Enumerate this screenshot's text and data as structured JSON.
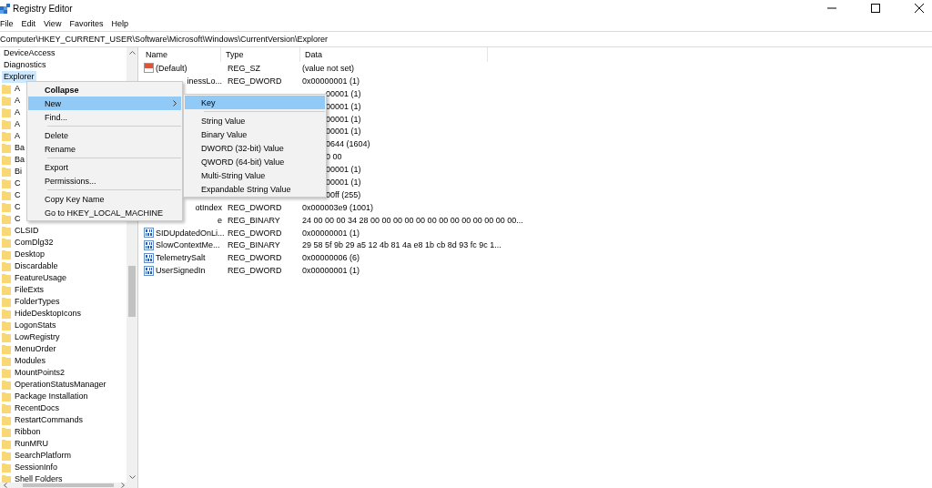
{
  "window": {
    "title": "Registry Editor"
  },
  "menu_bar": [
    "File",
    "Edit",
    "View",
    "Favorites",
    "Help"
  ],
  "address_bar": "Computer\\HKEY_CURRENT_USER\\Software\\Microsoft\\Windows\\CurrentVersion\\Explorer",
  "tree": [
    {
      "label": "DeviceAccess",
      "selected": false
    },
    {
      "label": "Diagnostics",
      "selected": false
    },
    {
      "label": "Explorer",
      "selected": true,
      "children": [
        {
          "label": "A",
          "selected": false
        },
        {
          "label": "A",
          "selected": false
        },
        {
          "label": "A",
          "selected": false
        },
        {
          "label": "A",
          "selected": false
        },
        {
          "label": "A",
          "selected": false
        },
        {
          "label": "Ba",
          "selected": false
        },
        {
          "label": "Ba",
          "selected": false
        },
        {
          "label": "Bi",
          "selected": false
        },
        {
          "label": "C",
          "selected": false
        },
        {
          "label": "C",
          "selected": false
        },
        {
          "label": "C",
          "selected": false
        },
        {
          "label": "C",
          "selected": false
        },
        {
          "label": "CLSID",
          "selected": false
        },
        {
          "label": "ComDlg32",
          "selected": false
        },
        {
          "label": "Desktop",
          "selected": false
        },
        {
          "label": "Discardable",
          "selected": false
        },
        {
          "label": "FeatureUsage",
          "selected": false
        },
        {
          "label": "FileExts",
          "selected": false
        },
        {
          "label": "FolderTypes",
          "selected": false
        },
        {
          "label": "HideDesktopIcons",
          "selected": false
        },
        {
          "label": "LogonStats",
          "selected": false
        },
        {
          "label": "LowRegistry",
          "selected": false
        },
        {
          "label": "MenuOrder",
          "selected": false
        },
        {
          "label": "Modules",
          "selected": false
        },
        {
          "label": "MountPoints2",
          "selected": false
        },
        {
          "label": "OperationStatusManager",
          "selected": false
        },
        {
          "label": "Package Installation",
          "selected": false
        },
        {
          "label": "RecentDocs",
          "selected": false
        },
        {
          "label": "RestartCommands",
          "selected": false
        },
        {
          "label": "Ribbon",
          "selected": false
        },
        {
          "label": "RunMRU",
          "selected": false
        },
        {
          "label": "SearchPlatform",
          "selected": false
        },
        {
          "label": "SessionInfo",
          "selected": false
        },
        {
          "label": "Shell Folders",
          "selected": false
        }
      ]
    }
  ],
  "table": {
    "columns": [
      "Name",
      "Type",
      "Data"
    ],
    "rows": [
      {
        "kind": "string",
        "name": "(Default)",
        "type": "REG_SZ",
        "data": "(value not set)"
      },
      {
        "name": "inessLo...",
        "type": "REG_DWORD",
        "data": "0x00000001 (1)"
      },
      {
        "data": "00001 (1)"
      },
      {
        "data": "00001 (1)"
      },
      {
        "data": "00001 (1)"
      },
      {
        "data": "00001 (1)"
      },
      {
        "data": "0644 (1604)"
      },
      {
        "data": "0 00"
      },
      {
        "data": "00001 (1)"
      },
      {
        "data": "00001 (1)"
      },
      {
        "data": "00ff (255)"
      },
      {
        "name": "otIndex",
        "type": "REG_DWORD",
        "data": "0x000003e9 (1001)"
      },
      {
        "name": "e",
        "type": "REG_BINARY",
        "data": "24 00 00 00 34 28 00 00 00 00 00 00 00 00 00 00 00 00 00..."
      },
      {
        "kind": "binary",
        "name": "SIDUpdatedOnLi...",
        "type": "REG_DWORD",
        "data": "0x00000001 (1)"
      },
      {
        "kind": "binary",
        "name": "SlowContextMe...",
        "type": "REG_BINARY",
        "data": "29 58 5f 9b 29 a5 12 4b 81 4a e8 1b cb 8d 93 fc 9c 1..."
      },
      {
        "kind": "binary",
        "name": "TelemetrySalt",
        "type": "REG_DWORD",
        "data": "0x00000006 (6)"
      },
      {
        "kind": "binary",
        "name": "UserSignedIn",
        "type": "REG_DWORD",
        "data": "0x00000001 (1)"
      }
    ]
  },
  "context_menu": [
    {
      "kind": "item",
      "label": "Collapse",
      "default": true,
      "selected": false
    },
    {
      "kind": "item",
      "label": "New",
      "selected": true,
      "submenu": true
    },
    {
      "kind": "item",
      "label": "Find...",
      "selected": false
    },
    {
      "kind": "separator"
    },
    {
      "kind": "item",
      "label": "Delete",
      "selected": false
    },
    {
      "kind": "item",
      "label": "Rename",
      "selected": false
    },
    {
      "kind": "separator"
    },
    {
      "kind": "item",
      "label": "Export",
      "selected": false
    },
    {
      "kind": "item",
      "label": "Permissions...",
      "selected": false
    },
    {
      "kind": "separator"
    },
    {
      "kind": "item",
      "label": "Copy Key Name",
      "selected": false
    },
    {
      "kind": "item",
      "label": "Go to HKEY_LOCAL_MACHINE",
      "selected": false
    }
  ],
  "submenu": [
    {
      "kind": "item",
      "label": "Key",
      "selected": true
    },
    {
      "kind": "separator"
    },
    {
      "kind": "item",
      "label": "String Value",
      "selected": false
    },
    {
      "kind": "item",
      "label": "Binary Value",
      "selected": false
    },
    {
      "kind": "item",
      "label": "DWORD (32-bit) Value",
      "selected": false
    },
    {
      "kind": "item",
      "label": "QWORD (64-bit) Value",
      "selected": false
    },
    {
      "kind": "item",
      "label": "Multi-String Value",
      "selected": false
    },
    {
      "kind": "item",
      "label": "Expandable String Value",
      "selected": false
    }
  ]
}
